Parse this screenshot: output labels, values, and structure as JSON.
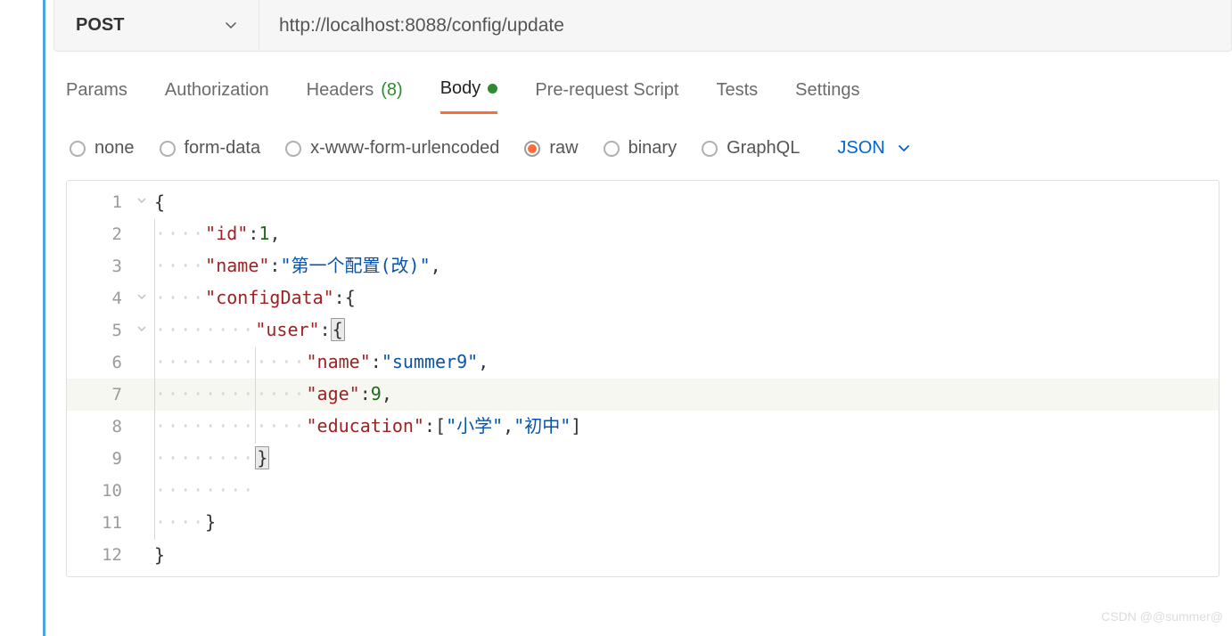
{
  "request": {
    "method": "POST",
    "url": "http://localhost:8088/config/update"
  },
  "tabs": {
    "params": "Params",
    "authorization": "Authorization",
    "headers_label": "Headers",
    "headers_count": "(8)",
    "body": "Body",
    "prerequest": "Pre-request Script",
    "tests": "Tests",
    "settings": "Settings"
  },
  "bodyTypes": {
    "none": "none",
    "formdata": "form-data",
    "urlencoded": "x-www-form-urlencoded",
    "raw": "raw",
    "binary": "binary",
    "graphql": "GraphQL"
  },
  "formatLabel": "JSON",
  "editor": {
    "lines": [
      "1",
      "2",
      "3",
      "4",
      "5",
      "6",
      "7",
      "8",
      "9",
      "10",
      "11",
      "12"
    ],
    "body_json": {
      "id": 1,
      "name": "第一个配置(改)",
      "configData": {
        "user": {
          "name": "summer9",
          "age": 9,
          "education": [
            "小学",
            "初中"
          ]
        }
      }
    },
    "tokens": {
      "id_key": "\"id\"",
      "id_val": "1",
      "name_key": "\"name\"",
      "name_val": "\"第一个配置(改)\"",
      "config_key": "\"configData\"",
      "user_key": "\"user\"",
      "uname_key": "\"name\"",
      "uname_val": "\"summer9\"",
      "age_key": "\"age\"",
      "age_val": "9",
      "edu_key": "\"education\"",
      "edu_v1": "\"小学\"",
      "edu_v2": "\"初中\""
    }
  },
  "watermark": "CSDN @@summer@"
}
